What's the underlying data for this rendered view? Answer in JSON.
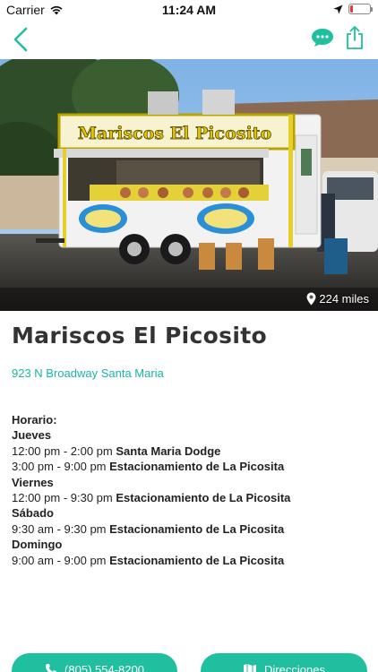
{
  "status_bar": {
    "carrier": "Carrier",
    "time": "11:24 AM",
    "battery_level": 0.15
  },
  "hero": {
    "truck_sign": "Mariscos El Picosito",
    "distance": "224 miles"
  },
  "truck": {
    "title": "Mariscos El Picosito",
    "address": "923 N Broadway Santa Maria"
  },
  "schedule": {
    "label": "Horario:",
    "days": [
      {
        "day": "Jueves",
        "slots": [
          {
            "time": "12:00 pm - 2:00 pm",
            "location": "Santa Maria Dodge"
          },
          {
            "time": "3:00 pm - 9:00 pm",
            "location": "Estacionamiento de La Picosita"
          }
        ]
      },
      {
        "day": "Viernes",
        "slots": [
          {
            "time": "12:00 pm - 9:30 pm",
            "location": "Estacionamiento de La Picosita"
          }
        ]
      },
      {
        "day": "Sábado",
        "slots": [
          {
            "time": "9:30 am - 9:30 pm",
            "location": "Estacionamiento de La Picosita"
          }
        ]
      },
      {
        "day": "Domingo",
        "slots": [
          {
            "time": "9:00 am - 9:00 pm",
            "location": "Estacionamiento de La Picosita"
          }
        ]
      }
    ]
  },
  "actions": {
    "phone": "(805) 554-8200",
    "directions": "Direcciones"
  },
  "colors": {
    "accent": "#1fbf9f",
    "link": "#1bb5a0",
    "battery_low": "#e53935"
  }
}
